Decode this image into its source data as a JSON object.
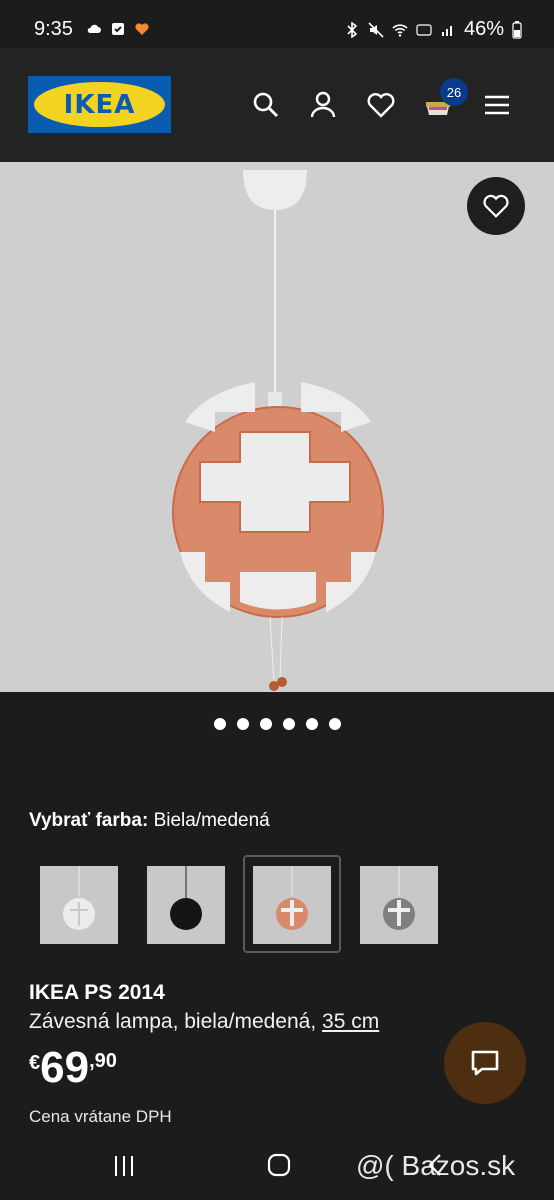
{
  "status_bar": {
    "time": "9:35",
    "battery": "46%"
  },
  "header": {
    "logo_text": "IKEA",
    "cart_count": "26"
  },
  "gallery": {
    "dot_count": 6
  },
  "color": {
    "label": "Vybrať farba:",
    "value": "Biela/medená"
  },
  "product": {
    "name": "IKEA PS 2014",
    "desc": "Závesná lampa, biela/medená,",
    "size": "35 cm",
    "currency": "€",
    "price_int": "69",
    "price_dec": ",90",
    "vat_note": "Cena vrátane DPH"
  },
  "watermark": "@( Bazos.sk",
  "colors": {
    "brand_blue": "#0a5cb0",
    "brand_yellow": "#f3d321",
    "copper": "#c96b4a"
  }
}
